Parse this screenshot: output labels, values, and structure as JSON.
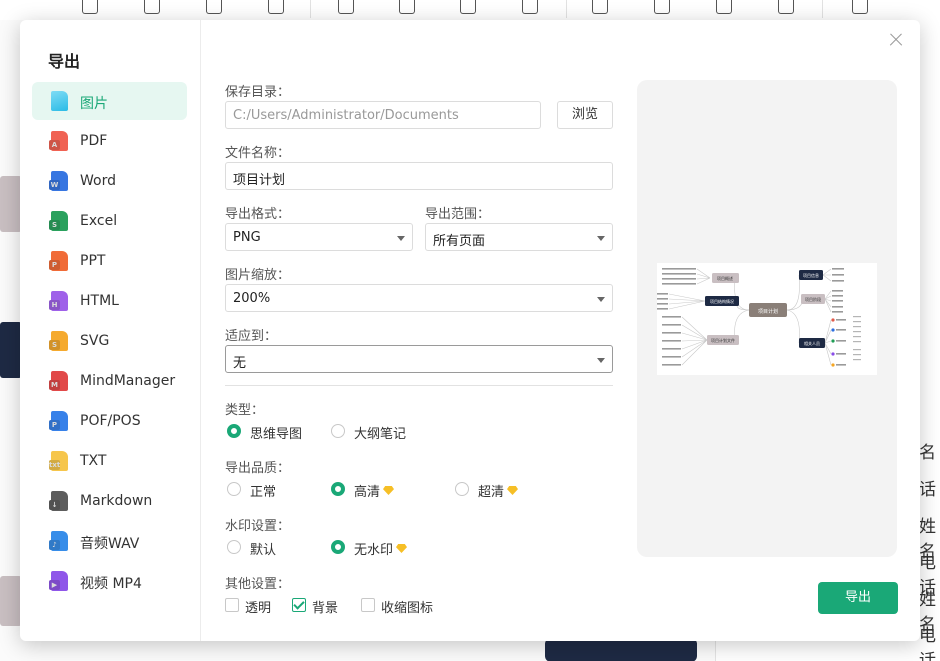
{
  "dialog": {
    "title": "导出",
    "export_button": "导出"
  },
  "sidebar": {
    "items": [
      {
        "label": "图片",
        "icon": "image-file-icon",
        "color": "#2bbbe6",
        "badge": ""
      },
      {
        "label": "PDF",
        "icon": "pdf-file-icon",
        "color": "#f05a4a",
        "badge": "A"
      },
      {
        "label": "Word",
        "icon": "word-file-icon",
        "color": "#2d6fe0",
        "badge": "W"
      },
      {
        "label": "Excel",
        "icon": "excel-file-icon",
        "color": "#1f9d55",
        "badge": "S"
      },
      {
        "label": "PPT",
        "icon": "ppt-file-icon",
        "color": "#f0642d",
        "badge": "P"
      },
      {
        "label": "HTML",
        "icon": "html-file-icon",
        "color": "#9a59e8",
        "badge": "H"
      },
      {
        "label": "SVG",
        "icon": "svg-file-icon",
        "color": "#f5a623",
        "badge": "S"
      },
      {
        "label": "MindManager",
        "icon": "mindmanager-file-icon",
        "color": "#e04040",
        "badge": "M"
      },
      {
        "label": "POF/POS",
        "icon": "pof-pos-file-icon",
        "color": "#2d7be8",
        "badge": "P"
      },
      {
        "label": "TXT",
        "icon": "txt-file-icon",
        "color": "#f6c343",
        "badge": "txt"
      },
      {
        "label": "Markdown",
        "icon": "markdown-file-icon",
        "color": "#555555",
        "badge": "↓"
      },
      {
        "label": "音频WAV",
        "icon": "audio-wav-file-icon",
        "color": "#2d87e8",
        "badge": "♪"
      },
      {
        "label": "视频 MP4",
        "icon": "video-mp4-file-icon",
        "color": "#8a4de8",
        "badge": "▶"
      }
    ]
  },
  "form": {
    "save_dir_label": "保存目录：",
    "save_dir_value": "C:/Users/Administrator/Documents",
    "browse_button": "浏览",
    "file_name_label": "文件名称：",
    "file_name_value": "项目计划",
    "format_label": "导出格式：",
    "format_value": "PNG",
    "range_label": "导出范围：",
    "range_value": "所有页面",
    "scale_label": "图片缩放：",
    "scale_value": "200%",
    "fit_label": "适应到：",
    "fit_value": "无",
    "type_label": "类型：",
    "type_options": [
      "思维导图",
      "大纲笔记"
    ],
    "quality_label": "导出品质：",
    "quality_options": [
      "正常",
      "高清",
      "超清"
    ],
    "watermark_label": "水印设置：",
    "watermark_options": [
      "默认",
      "无水印"
    ],
    "other_label": "其他设置：",
    "other_options": [
      "透明",
      "背景",
      "收缩图标"
    ]
  },
  "preview": {
    "center": "项目计划",
    "left_nodes": [
      "项目概述",
      "项目结构情况",
      "项目计划文件"
    ],
    "right_nodes": [
      "项目信息",
      "项目阶段",
      "相关人员"
    ]
  },
  "background": {
    "right_chars": [
      "名",
      "话",
      "姓名",
      "电话",
      "姓名",
      "电话"
    ],
    "left_chars": [
      "I",
      "目",
      "目"
    ]
  },
  "colors": {
    "accent": "#1aa877",
    "accent_bg": "#e6f7f1",
    "premium": "#f6bf26"
  }
}
